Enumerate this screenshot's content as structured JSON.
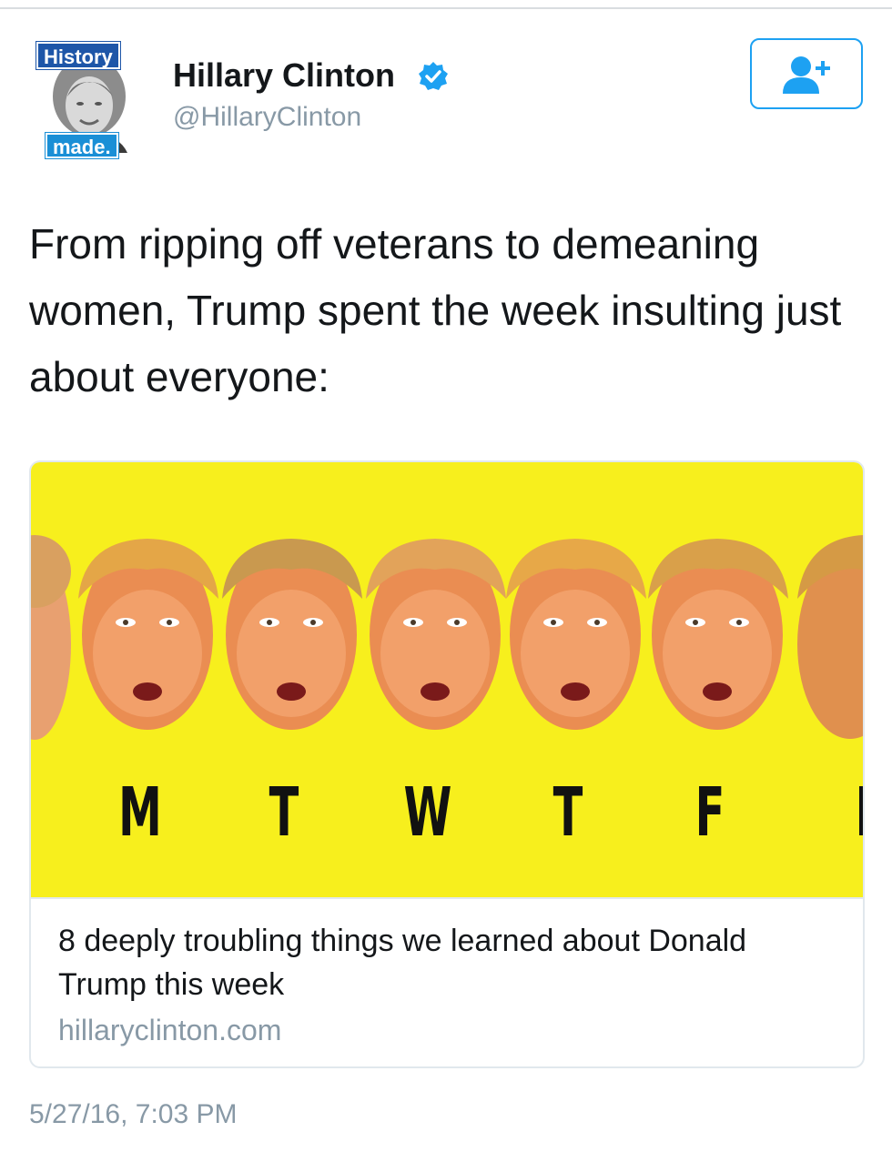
{
  "tweet": {
    "avatar": {
      "badge_top": "History",
      "badge_bottom": "made."
    },
    "user_name": "Hillary Clinton",
    "handle": "@HillaryClinton",
    "verified": true,
    "follow_icon": "add-user-icon",
    "text": "From ripping off veterans to demeaning women, Trump spent the week insulting just about everyone:",
    "card": {
      "image_letters": [
        "M",
        "T",
        "W",
        "T",
        "F"
      ],
      "title": "8 deeply troubling things we learned about Donald Trump this week",
      "domain": "hillaryclinton.com"
    },
    "timestamp": "5/27/16, 7:03 PM"
  },
  "colors": {
    "accent": "#1da1f2",
    "card_image_bg": "#f7ef1d",
    "secondary_text": "#8899a6"
  }
}
